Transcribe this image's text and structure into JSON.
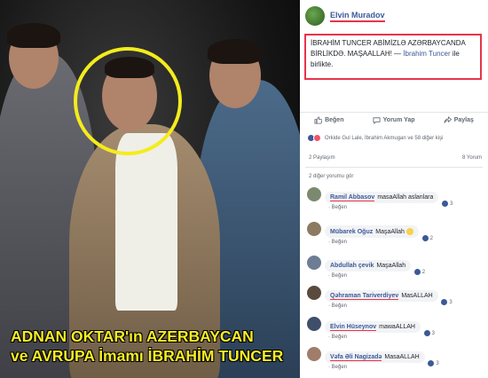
{
  "photo": {
    "caption_line1": "ADNAN OKTAR'ın AZERBAYCAN",
    "caption_line2": "ve AVRUPA İmamı İBRAHİM TUNCER",
    "highlight_color": "#f4ec1c"
  },
  "post": {
    "author": "Elvin Muradov",
    "text_main": "İBRAHİM TUNCER ABİMİZLƏ AZƏRBAYCANDA BİRLİKDƏ. MAŞAALLAH! — ",
    "text_tag": "İbrahim Tuncer",
    "text_tail": " ile birlikte."
  },
  "actions": {
    "like": "Beğen",
    "comment": "Yorum Yap",
    "share": "Paylaş"
  },
  "reactions_text": "Orkide Gul Lale, İbrahim Akmugan ve 58 diğer kişi",
  "stats": {
    "shares": "2 Paylaşım",
    "comments": "8 Yorum"
  },
  "previous_comments": "2 diğer yorumu gör",
  "comment_meta": "· Beğen",
  "comments": [
    {
      "name": "Ramil Abbasov",
      "text": "masaAllah aslanlara",
      "likes": "3"
    },
    {
      "name": "Mübarek Oğuz",
      "text": "MaşaAllah",
      "likes": "2"
    },
    {
      "name": "Abdullah çevik",
      "text": "MaşaAllah",
      "likes": "2"
    },
    {
      "name": "Qəhraman Tariverdiyev",
      "text": "MasALLAH",
      "likes": "3"
    },
    {
      "name": "Elvin Hüseynov",
      "text": "mawaALLAH",
      "likes": "3"
    },
    {
      "name": "Vəfa Əli Nagizadə",
      "text": "MasaALLAH",
      "likes": "3"
    }
  ],
  "colors": {
    "link": "#3b5998",
    "underline": "#e8344a"
  }
}
